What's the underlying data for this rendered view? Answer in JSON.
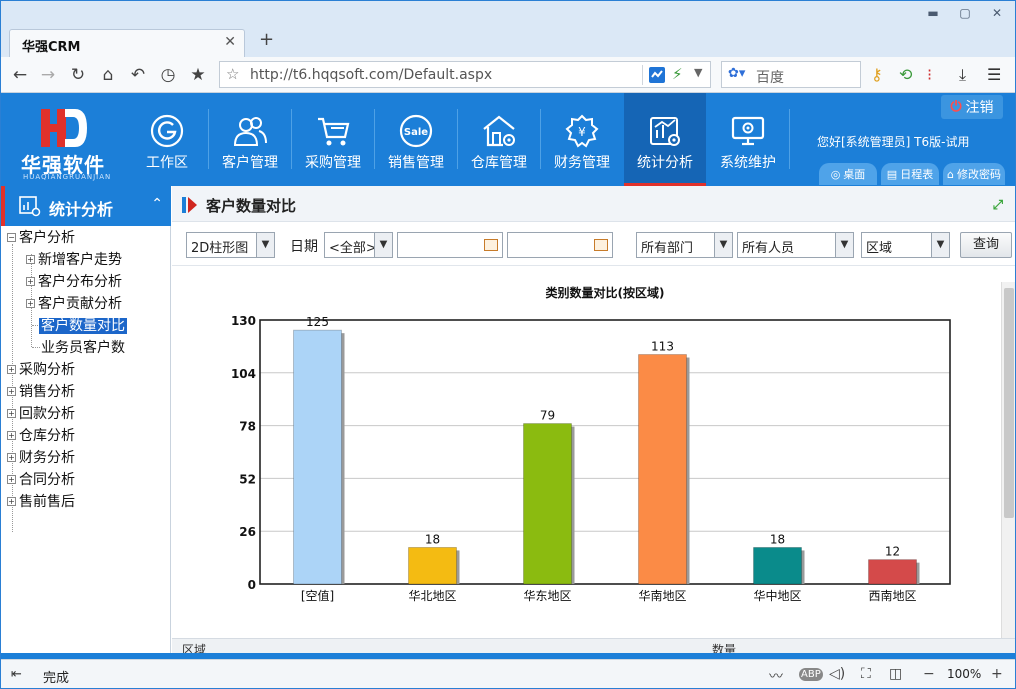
{
  "browser": {
    "tab_title": "华强CRM",
    "url": "http://t6.hqqsoft.com/Default.aspx",
    "search_placeholder": "百度"
  },
  "header": {
    "logo_text": "华强软件",
    "logo_sub": "HUAQIANGRUANJIAN",
    "menus": [
      {
        "label": "工作区",
        "icon": "g-icon"
      },
      {
        "label": "客户管理",
        "icon": "users-icon"
      },
      {
        "label": "采购管理",
        "icon": "cart-icon"
      },
      {
        "label": "销售管理",
        "icon": "sale-icon"
      },
      {
        "label": "仓库管理",
        "icon": "warehouse-icon"
      },
      {
        "label": "财务管理",
        "icon": "yuan-icon"
      },
      {
        "label": "统计分析",
        "icon": "stats-icon"
      },
      {
        "label": "系统维护",
        "icon": "monitor-gear-icon"
      }
    ],
    "logout_label": "注销",
    "welcome": "您好[系统管理员] T6版-试用",
    "quick_buttons": [
      "桌面",
      "日程表",
      "修改密码"
    ]
  },
  "sidebar": {
    "title": "统计分析",
    "tree": [
      {
        "label": "客户分析",
        "level": 0,
        "expanded": true
      },
      {
        "label": "新增客户走势",
        "level": 1,
        "toggle": true
      },
      {
        "label": "客户分布分析",
        "level": 1,
        "toggle": true
      },
      {
        "label": "客户贡献分析",
        "level": 1,
        "toggle": true
      },
      {
        "label": "客户数量对比",
        "level": 1,
        "selected": true
      },
      {
        "label": "业务员客户数",
        "level": 1
      },
      {
        "label": "采购分析",
        "level": 0
      },
      {
        "label": "销售分析",
        "level": 0
      },
      {
        "label": "回款分析",
        "level": 0
      },
      {
        "label": "仓库分析",
        "level": 0
      },
      {
        "label": "财务分析",
        "level": 0
      },
      {
        "label": "合同分析",
        "level": 0
      },
      {
        "label": "售前售后",
        "level": 0
      }
    ]
  },
  "page": {
    "title": "客户数量对比",
    "filters": {
      "chart_type": "2D柱形图",
      "date_label": "日期",
      "date_range": "<全部>",
      "date_from": "",
      "date_to": "",
      "department": "所有部门",
      "staff": "所有人员",
      "group_by": "区域",
      "query_label": "查询"
    },
    "table_headers": [
      "区域",
      "数量"
    ]
  },
  "chart_data": {
    "type": "bar",
    "title": "类别数量对比(按区域)",
    "categories": [
      "[空值]",
      "华北地区",
      "华东地区",
      "华南地区",
      "华中地区",
      "西南地区"
    ],
    "values": [
      125,
      18,
      79,
      113,
      18,
      12
    ],
    "colors": [
      "#acd4f7",
      "#f4bb12",
      "#8bbb10",
      "#fb8b46",
      "#0a8b8b",
      "#d44a4a"
    ],
    "ylim": [
      0,
      130
    ],
    "yticks": [
      0,
      26,
      52,
      78,
      104,
      130
    ],
    "grid": true
  },
  "status": {
    "text": "完成",
    "zoom": "100%"
  }
}
